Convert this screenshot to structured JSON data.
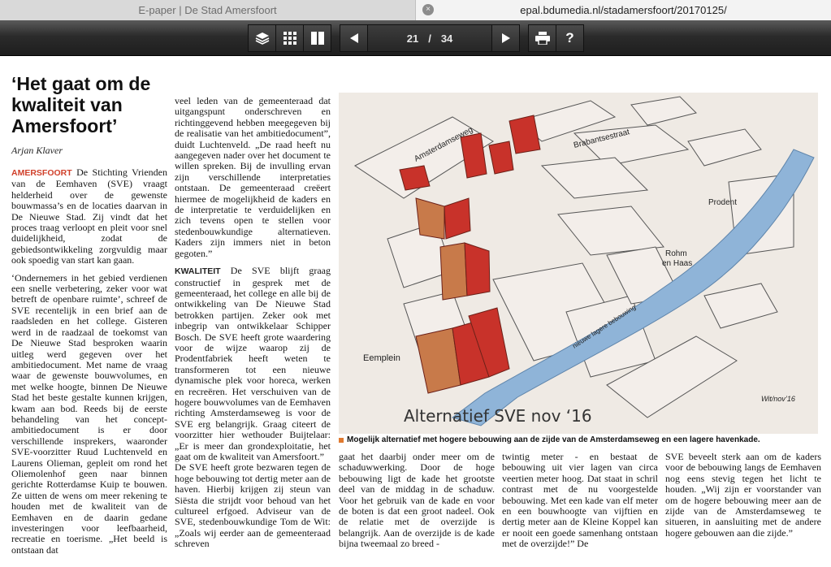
{
  "tabs": [
    {
      "title": "E-paper | De Stad Amersfoort"
    },
    {
      "title": "epal.bdumedia.nl/stadamersfoort/20170125/",
      "close": "×"
    }
  ],
  "toolbar": {
    "page_current": "21",
    "page_separator": "/",
    "page_total": "34",
    "help": "?",
    "icons": [
      "layers-icon",
      "grid-icon",
      "double-page-icon",
      "prev-arrow-icon",
      "next-arrow-icon",
      "print-icon",
      "help-icon"
    ]
  },
  "article": {
    "title": "‘Het gaat om de kwaliteit van Amersfoort’",
    "author": "Arjan Klaver",
    "col1": {
      "dateline": "AMERSFOORT",
      "p1": "De Stichting Vrienden van de Eemhaven (SVE) vraagt helderheid over de gewenste bouwmassa’s en de locaties daarvan in De Nieuwe Stad. Zij vindt dat het proces traag verloopt en pleit voor snel duidelijkheid, zodat de gebiedsontwikkeling zorgvuldig maar ook spoedig van start kan gaan.",
      "p2": "‘Ondernemers in het gebied verdienen een snelle verbetering, zeker voor wat betreft de openbare ruimte’, schreef de SVE recentelijk in een brief aan de raadsleden en het college. Gisteren werd in de raadzaal de toekomst van De Nieuwe Stad besproken waarin uitleg werd gegeven over het ambitiedocument. Met name de vraag waar de gewenste bouwvolumes, en met welke hoogte, binnen De Nieuwe Stad het beste gestalte kunnen krijgen, kwam aan bod. Reeds bij de eerste behandeling van het concept-ambitiedocument is er door verschillende insprekers, waaronder SVE-voorzitter Ruud Luchtenveld en Laurens Olieman, gepleit om rond het Oliemolenhof geen naar binnen gerichte Rotterdamse Kuip te bouwen. Ze uitten de wens om meer rekening te houden met de kwaliteit van de Eemhaven en de daarin gedane investeringen voor leefbaarheid, recreatie en toerisme. „Het beeld is ontstaan dat"
    },
    "col2": {
      "p1": "veel leden van de gemeenteraad dat uitgangspunt onderschreven en richtinggevend hebben meegegeven bij de realisatie van het ambitiedocument”, duidt Luchtenveld. „De raad heeft nu aangegeven nader over het document te willen spreken. Bij de invulling ervan zijn verschillende interpretaties ontstaan. De gemeenteraad creëert hiermee de mogelijkheid de kaders en de interpretatie te verduidelijken en zich tevens open te stellen voor stedenbouwkundige alternatieven. Kaders zijn immers niet in beton gegoten.”",
      "kicker": "KWALITEIT",
      "p2": "De SVE blijft graag constructief in gesprek met de gemeenteraad, het college en alle bij de ontwikkeling van De Nieuwe Stad betrokken partijen. Zeker ook met inbegrip van ontwikkelaar Schipper Bosch. De SVE heeft grote waardering voor de wijze waarop zij de Prodentfabriek heeft weten te transformeren tot een nieuwe dynamische plek voor horeca, werken en recreëren. Het verschuiven van de hogere bouwvolumes van de Eemhaven richting Amsterdamseweg is voor de SVE erg belangrijk. Graag citeert de voorzitter hier wethouder Buijtelaar: „Er is meer dan grondexploitatie, het gaat om de kwaliteit van Amersfoort.”",
      "p3": "De SVE heeft grote bezwaren tegen de hoge bebouwing tot dertig meter aan de haven. Hierbij krijgen zij steun van Siësta die strijdt voor behoud van het cultureel erfgoed. Adviseur van de SVE, stedenbouwkundige Tom de Wit: „Zoals wij eerder aan de gemeenteraad schreven"
    },
    "col3": "gaat het daarbij onder meer om de schaduwwerking. Door de hoge bebouwing ligt de kade het grootste deel van de middag in de schaduw. Voor het gebruik van de kade en voor de boten is dat een groot nadeel. Ook de relatie met de overzijde is belangrijk. Aan de overzijde is de kade bijna tweemaal zo breed -",
    "col4": "twintig meter - en bestaat de bebouwing uit vier lagen van circa veertien meter hoog. Dat staat in schril contrast met de nu voorgestelde bebouwing. Met een kade van elf meter en een bouwhoogte van vijftien en dertig meter aan de Kleine Koppel kan er nooit een goede samenhang ontstaan met de overzijde!” De",
    "col5": "SVE beveelt sterk aan om de kaders voor de bebouwing langs de Eemhaven nog eens stevig tegen het licht te houden. „Wij zijn er voorstander van om de hogere bebouwing meer aan de zijde van de Amsterdamseweg te situeren, in aansluiting met de andere hogere gebouwen aan die zijde.”"
  },
  "illustration": {
    "labels": {
      "amsterdamseweg": "Amsterdamseweg",
      "brabantsestraat": "Brabantsestraat",
      "prodent": "Prodent",
      "rohm": "Rohm",
      "en_haas": "en Haas",
      "eemplein": "Eemplein",
      "lagere": "nieuwe lagere bebouwing",
      "signature": "Wit/nov’16"
    },
    "title": "Alternatief SVE nov ‘16",
    "caption": "Mogelijk alternatief met hogere bebouwing aan de zijde van de Amsterdamseweg en een lagere havenkade."
  },
  "colors": {
    "red_building": "#c8322a",
    "orange_building": "#c87a4a",
    "water": "#8fb4d8",
    "building": "#f3eeea",
    "accent": "#d0402b"
  }
}
